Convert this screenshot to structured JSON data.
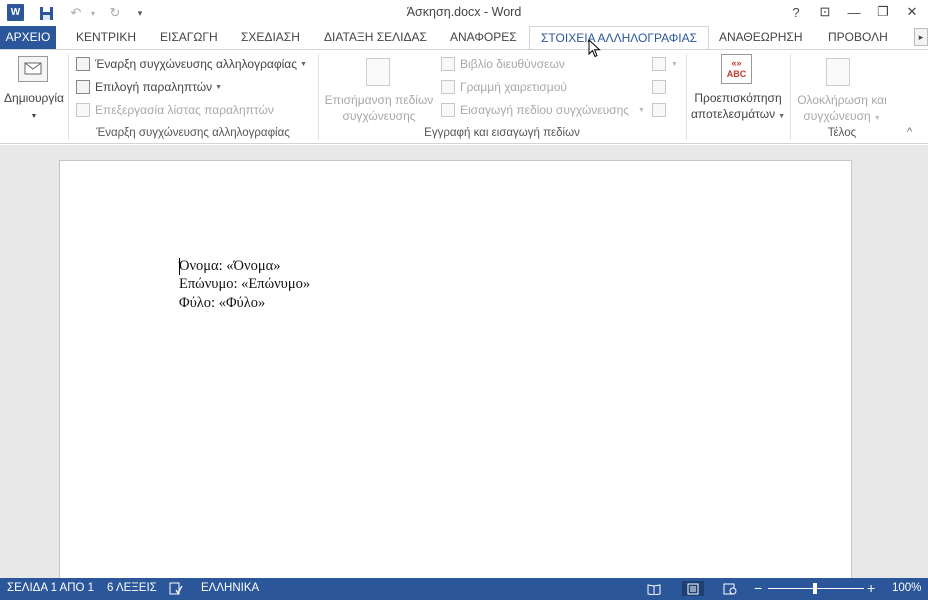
{
  "window": {
    "title": "Άσκηση.docx - Word",
    "logo_text": "W",
    "qat": {
      "save": "💾",
      "undo": "↶",
      "redo": "↻",
      "customize": "▾"
    },
    "controls": {
      "help": "?",
      "ribbon_options": "⊡",
      "minimize": "—",
      "restore": "❐",
      "close": "✕"
    }
  },
  "tabs": {
    "file": "ΑΡΧΕΙΟ",
    "items": [
      "ΚΕΝΤΡΙΚΗ",
      "ΕΙΣΑΓΩΓΗ",
      "ΣΧΕΔΙΑΣΗ",
      "ΔΙΑΤΑΞΗ ΣΕΛΙΔΑΣ",
      "ΑΝΑΦΟΡΕΣ",
      "ΣΤΟΙΧΕΙΑ ΑΛΛΗΛΟΓΡΑΦΙΑΣ",
      "ΑΝΑΘΕΩΡΗΣΗ",
      "ΠΡΟΒΟΛΗ"
    ],
    "active": "ΣΤΟΙΧΕΙΑ ΑΛΛΗΛΟΓΡΑΦΙΑΣ",
    "scroll_glyph": "▸"
  },
  "ribbon": {
    "create": {
      "label": "Δημιουργία"
    },
    "start_group": {
      "label": "Έναρξη συγχώνευσης αλληλογραφίας",
      "start_merge": "Έναρξη συγχώνευσης αλληλογραφίας",
      "select_recipients": "Επιλογή παραληπτών",
      "edit_list": "Επεξεργασία λίστας παραληπτών"
    },
    "write_group": {
      "label": "Εγγραφή και εισαγωγή πεδίων",
      "highlight_fields_line1": "Επισήμανση πεδίων",
      "highlight_fields_line2": "συγχώνευσης",
      "address_block": "Βιβλίο διευθύνσεων",
      "greeting_line": "Γραμμή χαιρετισμού",
      "insert_field": "Εισαγωγή πεδίου συγχώνευσης"
    },
    "preview": {
      "line1": "Προεπισκόπηση",
      "line2": "αποτελεσμάτων",
      "icon_text": "ABC",
      "icon_top": "«»"
    },
    "finish_group": {
      "label": "Τέλος",
      "finish_line1": "Ολοκλήρωση και",
      "finish_line2": "συγχώνευση"
    },
    "collapse_glyph": "^"
  },
  "document": {
    "lines": [
      "Όνομα: «Όνομα»",
      "Επώνυμο: «Επώνυμο»",
      "Φύλο: «Φύλο»"
    ]
  },
  "statusbar": {
    "page": "ΣΕΛΙΔΑ 1 ΑΠΟ 1",
    "words": "6 ΛΕΞΕΙΣ",
    "language": "ΕΛΛΗΝΙΚΑ",
    "zoom": "100%",
    "zoom_out": "−",
    "zoom_in": "+"
  },
  "colors": {
    "accent": "#2b579a",
    "statusbar": "#2b579a",
    "preview_icon": "#c0392b"
  }
}
